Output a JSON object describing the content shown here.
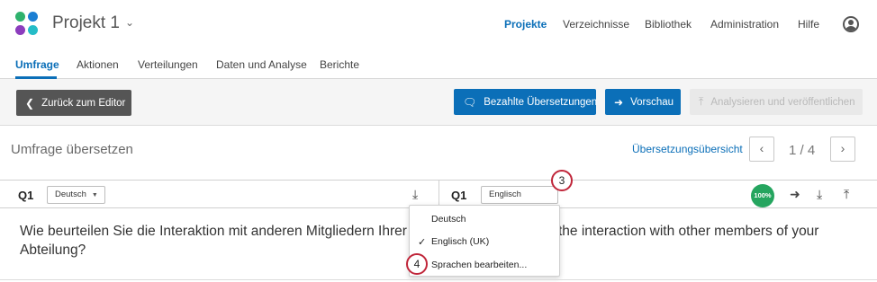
{
  "header": {
    "project_title": "Projekt 1",
    "nav": [
      "Projekte",
      "Verzeichnisse",
      "Bibliothek",
      "Administration",
      "Hilfe"
    ],
    "active_nav": "Projekte",
    "logo_colors": [
      "#2fb26d",
      "#1b7fd3",
      "#8c3dbd",
      "#25bcc7"
    ]
  },
  "tabs": [
    "Umfrage",
    "Aktionen",
    "Verteilungen",
    "Daten und Analyse",
    "Berichte"
  ],
  "active_tab": "Umfrage",
  "toolbar": {
    "back_label": "Zurück zum Editor",
    "paid_translations_label": "Bezahlte Übersetzungen",
    "preview_label": "Vorschau",
    "publish_label": "Analysieren und veröffentlichen"
  },
  "section": {
    "title": "Umfrage übersetzen",
    "overview_link": "Übersetzungsübersicht",
    "pager_text": "1 / 4"
  },
  "question_row": {
    "left_label": "Q1",
    "left_language": "Deutsch",
    "right_label": "Q1",
    "right_language": "Englisch (UK)",
    "progress_badge": "100%"
  },
  "question": {
    "source_text": "Wie beurteilen Sie die Interaktion mit anderen Mitgliedern Ihrer Abteilung?",
    "translation_text": "the interaction with other members of your"
  },
  "dropdown": {
    "options": [
      "Deutsch",
      "Englisch (UK)",
      "Sprachen bearbeiten..."
    ],
    "selected": "Englisch (UK)"
  },
  "callouts": [
    "3",
    "4"
  ],
  "colors": {
    "accent": "#0b6fb8",
    "dark_button": "#555555",
    "badge_green": "#25a55f",
    "callout_red": "#c0263a"
  }
}
